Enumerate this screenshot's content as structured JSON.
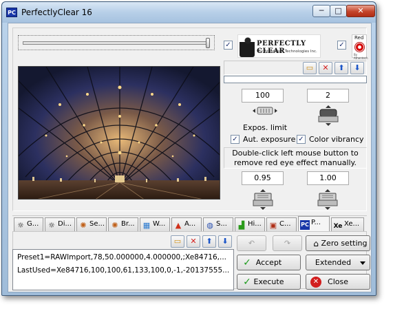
{
  "window": {
    "title": "PerfectlyClear 16",
    "app_icon": "PC",
    "controls": {
      "minimize": "─",
      "maximize": "□",
      "close": "✕"
    }
  },
  "top": {
    "slider_checkbox": true,
    "logo_checkbox": true,
    "logo_red_checkbox": true,
    "logo": {
      "name": "PERFECTLY CLEAR",
      "byline": "By Athentech Technologies Inc."
    },
    "logo_red": {
      "label": "Red",
      "small": "By Athentech"
    }
  },
  "file_toolbar": {
    "folder_icon": "folder-icon",
    "delete_icon": "delete-icon",
    "up_icon": "arrow-up-icon",
    "down_icon": "arrow-down-icon",
    "glyphs": {
      "folder": "▭",
      "delete": "✕",
      "up": "⬆",
      "down": "⬇"
    }
  },
  "controls": {
    "value1": "100",
    "value2": "2",
    "value3": "0.95",
    "value4": "1.00",
    "expos_limit_label": "Expos. limit",
    "aut_exposure": {
      "label": "Aut. exposure",
      "checked": true
    },
    "color_vibrancy": {
      "label": "Color vibrancy",
      "checked": true
    },
    "redeye_hint": "Double-click left mouse button to remove red eye effect manually."
  },
  "tabs": [
    {
      "label": "G...",
      "icon": "sun-icon",
      "glyph": "☼"
    },
    {
      "label": "Di...",
      "icon": "sun-icon",
      "glyph": "☼"
    },
    {
      "label": "Se...",
      "icon": "sun-color-icon",
      "glyph": "✺"
    },
    {
      "label": "Br...",
      "icon": "sun-color-icon",
      "glyph": "✺"
    },
    {
      "label": "W...",
      "icon": "palette-icon",
      "glyph": "▦"
    },
    {
      "label": "A...",
      "icon": "prism-icon",
      "glyph": "▲"
    },
    {
      "label": "S...",
      "icon": "spiral-icon",
      "glyph": "◍"
    },
    {
      "label": "Hi...",
      "icon": "histogram-icon",
      "glyph": "▟"
    },
    {
      "label": "C...",
      "icon": "crop-icon",
      "glyph": "▣"
    },
    {
      "label": "P...",
      "icon": "pc-icon",
      "glyph": "PC",
      "active": true
    },
    {
      "label": "Xe...",
      "icon": "xe-icon",
      "glyph": "Xe"
    }
  ],
  "presets": {
    "line1": "Preset1=RAWImport,78,50.000000,4.000000,;Xe84716,...",
    "line2": "LastUsed=Xe84716,100,100,61,133,100,0,-1,-20137555..."
  },
  "buttons": {
    "undo": "↶",
    "redo": "↷",
    "zero_setting": "Zero setting",
    "accept": "Accept",
    "extended": "Extended",
    "execute": "Execute",
    "close": "Close"
  }
}
